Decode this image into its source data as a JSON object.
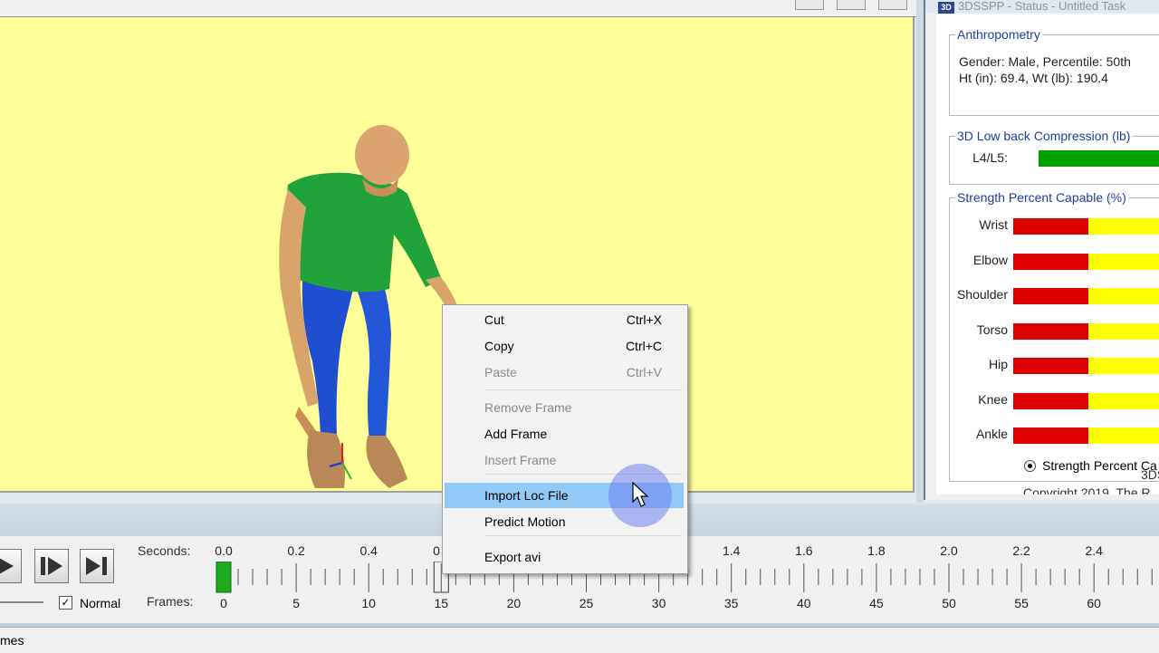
{
  "status_window": {
    "title": "3DSSPP - Status - Untitled Task",
    "icon": "3D",
    "anthropometry": {
      "legend": "Anthropometry",
      "line1": "Gender: Male, Percentile: 50th",
      "line2": "Ht (in): 69.4, Wt (lb): 190.4"
    },
    "low_back": {
      "legend": "3D Low back Compression (lb)",
      "label": "L4/L5:",
      "level_color": "#00a000"
    },
    "strength": {
      "legend": "Strength Percent Capable (%)",
      "rows": [
        "Wrist",
        "Elbow",
        "Shoulder",
        "Torso",
        "Hip",
        "Knee",
        "Ankle"
      ],
      "radio_label": "Strength Percent Ca",
      "colors": {
        "low": "#dd0000",
        "mid": "#ffff00"
      }
    },
    "footer_partial_1": "3DS",
    "footer_partial_2": "Copyright 2019, The R"
  },
  "viewport": {
    "background": "#ffff99"
  },
  "context_menu": {
    "items": [
      {
        "label": "Cut",
        "shortcut": "Ctrl+X",
        "enabled": true
      },
      {
        "label": "Copy",
        "shortcut": "Ctrl+C",
        "enabled": true
      },
      {
        "label": "Paste",
        "shortcut": "Ctrl+V",
        "enabled": false
      },
      {
        "label": "Remove Frame",
        "shortcut": "",
        "enabled": false
      },
      {
        "label": "Add Frame",
        "shortcut": "",
        "enabled": true
      },
      {
        "label": "Insert Frame",
        "shortcut": "",
        "enabled": false
      },
      {
        "label": "Import Loc File",
        "shortcut": "",
        "enabled": true,
        "highlighted": true
      },
      {
        "label": "Predict Motion",
        "shortcut": "",
        "enabled": true
      },
      {
        "label": "Export avi",
        "shortcut": "",
        "enabled": true
      }
    ]
  },
  "timeline": {
    "seconds_label": "Seconds:",
    "frames_label": "Frames:",
    "normal_label": "Normal",
    "normal_checked": true,
    "seconds_ticks": [
      "0.0",
      "0.2",
      "0.4",
      "0",
      "1.4",
      "1.6",
      "1.8",
      "2.0",
      "2.2",
      "2.4"
    ],
    "frame_ticks": [
      "0",
      "5",
      "10",
      "15",
      "20",
      "25",
      "30",
      "35",
      "40",
      "45",
      "50",
      "55",
      "60"
    ],
    "current_frame": 15
  },
  "status_bar": {
    "text": "mes"
  }
}
